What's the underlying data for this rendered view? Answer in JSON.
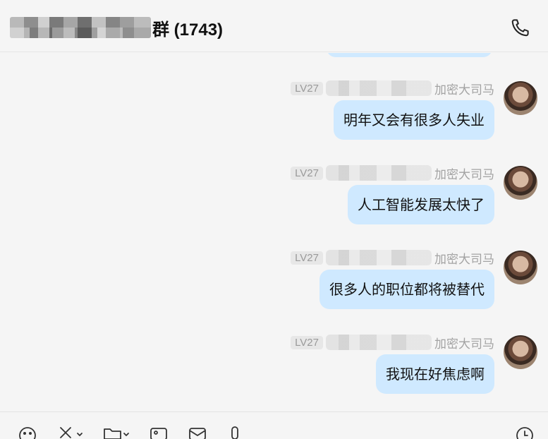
{
  "header": {
    "title_visible": "群 (1743)"
  },
  "messages": [
    {
      "level": "LV27",
      "name_suffix": "加密大司马",
      "text": "明年又会有很多人失业"
    },
    {
      "level": "LV27",
      "name_suffix": "加密大司马",
      "text": "人工智能发展太快了"
    },
    {
      "level": "LV27",
      "name_suffix": "加密大司马",
      "text": "很多人的职位都将被替代"
    },
    {
      "level": "LV27",
      "name_suffix": "加密大司马",
      "text": "我现在好焦虑啊"
    }
  ],
  "toolbar": {
    "items": [
      "emoji-icon",
      "scissors-icon",
      "folder-icon",
      "image-icon",
      "mailbox-icon",
      "microphone-icon",
      "clock-icon"
    ]
  },
  "colors": {
    "bubble": "#cfe9ff",
    "background": "#f5f5f5"
  }
}
